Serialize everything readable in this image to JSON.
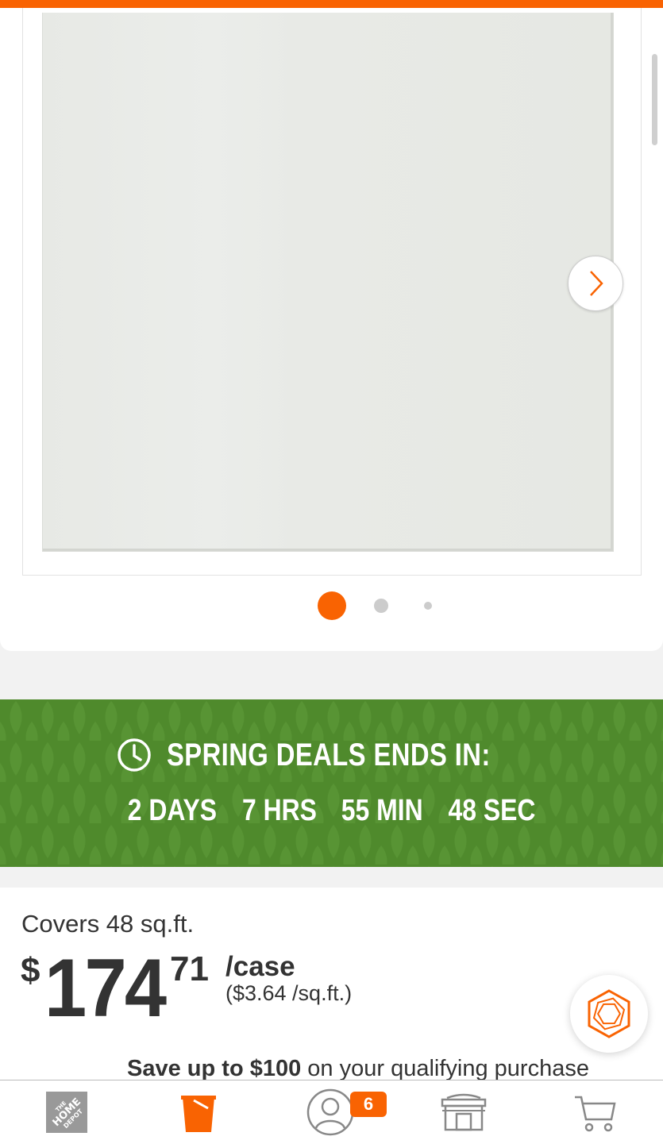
{
  "colors": {
    "brand_orange": "#f96302",
    "deal_green": "#4f8a2c",
    "text": "#333333"
  },
  "carousel": {
    "total_images": 3,
    "active_index": 0,
    "image": "white-wall-tile-image",
    "next_icon": "chevron-right-icon"
  },
  "deal_banner": {
    "icon": "clock-icon",
    "title": "SPRING DEALS ENDS IN:",
    "countdown": {
      "days": "2 DAYS",
      "hours": "7 HRS",
      "minutes": "55 MIN",
      "seconds": "48 SEC"
    }
  },
  "pricing": {
    "coverage": "Covers 48 sq.ft.",
    "currency_symbol": "$",
    "whole": "174",
    "cents": "71",
    "unit": "/case",
    "per_unit": "($3.64 /sq.ft.)",
    "savings_bold": "Save up to $100",
    "savings_rest": " on your qualifying purchase"
  },
  "chat": {
    "icon": "hexagon-chat-icon"
  },
  "bottom_nav": {
    "items": [
      {
        "name": "home",
        "icon": "home-depot-logo-icon",
        "active": false
      },
      {
        "name": "shop",
        "icon": "bucket-icon",
        "active": true
      },
      {
        "name": "account",
        "icon": "user-icon",
        "active": false,
        "badge": "6"
      },
      {
        "name": "store",
        "icon": "store-icon",
        "active": false
      },
      {
        "name": "cart",
        "icon": "cart-icon",
        "active": false
      }
    ]
  }
}
